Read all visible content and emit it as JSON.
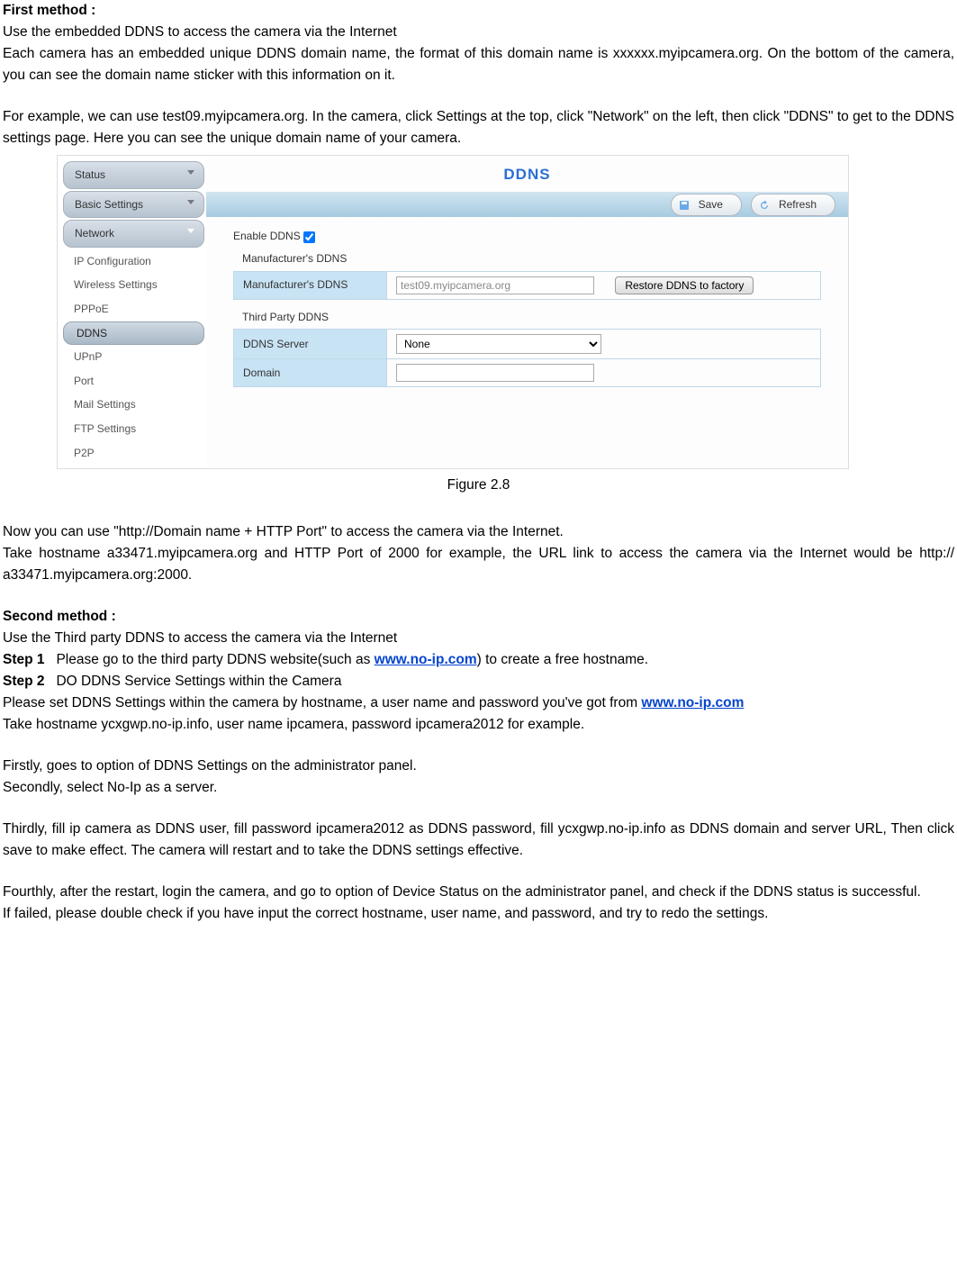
{
  "doc": {
    "first_method_title": "First method :",
    "p1": "Use the embedded DDNS to access the camera via the Internet",
    "p2": "Each camera has an embedded unique DDNS domain name, the format of this domain name is xxxxxx.myipcamera.org. On the bottom of the camera, you can see the domain name sticker with this information on it.",
    "p3": "For example, we can use test09.myipcamera.org. In the camera, click Settings at the top, click \"Network\" on the left, then click \"DDNS\" to get to the DDNS settings page. Here you can see the unique domain name of your camera.",
    "figure_caption": "Figure 2.8",
    "p4": "Now you can use \"http://Domain name + HTTP Port\" to access the camera via the Internet.",
    "p5": "Take hostname a33471.myipcamera.org and HTTP Port of 2000 for example, the URL link to access the camera via the Internet would be http:// a33471.myipcamera.org:2000.",
    "second_method_title": "Second method :",
    "p6": "Use the Third party DDNS to access the camera via the Internet",
    "step1_label": "Step 1",
    "step1_text_a": "Please go to the third party DDNS website(such as ",
    "step1_link": "www.no-ip.com",
    "step1_text_b": ") to create a free hostname.",
    "step2_label": "Step 2",
    "step2_text": "DO DDNS Service Settings within the Camera",
    "p7a": "Please set DDNS Settings within the camera by hostname, a user name and password you've got from ",
    "p7_link": "www.no-ip.com",
    "p8": "Take hostname ycxgwp.no-ip.info, user name ipcamera, password ipcamera2012 for example.",
    "p9": "Firstly, goes to option of DDNS Settings on the administrator panel.",
    "p10": "Secondly, select No-Ip as a server.",
    "p11": "Thirdly, fill ip camera as DDNS user, fill password ipcamera2012 as DDNS password, fill ycxgwp.no-ip.info as DDNS domain and server URL, Then click save to make effect. The camera will restart and to take the DDNS settings effective.",
    "p12": "Fourthly, after the restart, login the camera, and go to option of Device Status on the administrator panel, and check if the DDNS status is successful.",
    "p13": "If failed, please double check if you have input the correct hostname, user name, and password, and try to redo the settings."
  },
  "ui": {
    "sidebar": {
      "status": "Status",
      "basic": "Basic Settings",
      "network": "Network",
      "items": {
        "ip": "IP Configuration",
        "wireless": "Wireless Settings",
        "pppoe": "PPPoE",
        "ddns": "DDNS",
        "upnp": "UPnP",
        "port": "Port",
        "mail": "Mail Settings",
        "ftp": "FTP Settings",
        "p2p": "P2P"
      }
    },
    "title": "DDNS",
    "save": "Save",
    "refresh": "Refresh",
    "enable_label": "Enable DDNS",
    "section_manuf": "Manufacturer's DDNS",
    "row_manuf_label": "Manufacturer's DDNS",
    "manuf_value": "test09.myipcamera.org",
    "restore_btn": "Restore DDNS to factory",
    "section_third": "Third Party DDNS",
    "row_server_label": "DDNS Server",
    "server_value": "None",
    "row_domain_label": "Domain",
    "domain_value": ""
  }
}
